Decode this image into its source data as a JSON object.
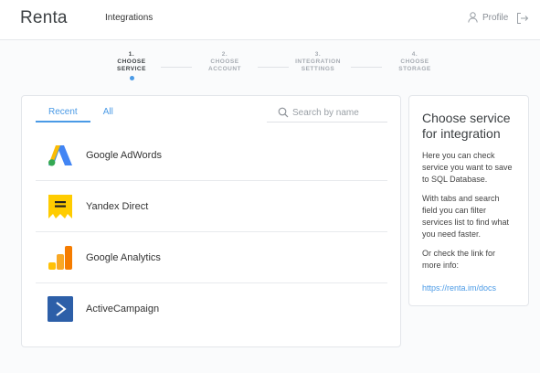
{
  "header": {
    "logo": "Renta",
    "nav_link": "Integrations",
    "profile_label": "Profile"
  },
  "steps": [
    {
      "number": "1.",
      "label_line1": "CHOOSE",
      "label_line2": "SERVICE",
      "active": true
    },
    {
      "number": "2.",
      "label_line1": "CHOOSE",
      "label_line2": "ACCOUNT",
      "active": false
    },
    {
      "number": "3.",
      "label_line1": "INTEGRATION",
      "label_line2": "SETTINGS",
      "active": false
    },
    {
      "number": "4.",
      "label_line1": "CHOOSE",
      "label_line2": "STORAGE",
      "active": false
    }
  ],
  "tabs": {
    "recent": "Recent",
    "all": "All",
    "active": "Recent"
  },
  "search": {
    "placeholder": "Search by name",
    "value": ""
  },
  "services": [
    {
      "name": "Google AdWords",
      "icon": "google-adwords-icon"
    },
    {
      "name": "Yandex Direct",
      "icon": "yandex-direct-icon"
    },
    {
      "name": "Google Analytics",
      "icon": "google-analytics-icon"
    },
    {
      "name": "ActiveCampaign",
      "icon": "activecampaign-icon"
    }
  ],
  "sidebar": {
    "title": "Choose service for integration",
    "p1": "Here you can check service you want to save to SQL Database.",
    "p2": "With tabs and search field you can filter services list to find what you need faster.",
    "p3": "Or check the link for more info:",
    "link": "https://renta.im/docs"
  },
  "colors": {
    "accent": "#4a9ae6",
    "text": "#333333",
    "muted": "#9aa0a6"
  }
}
